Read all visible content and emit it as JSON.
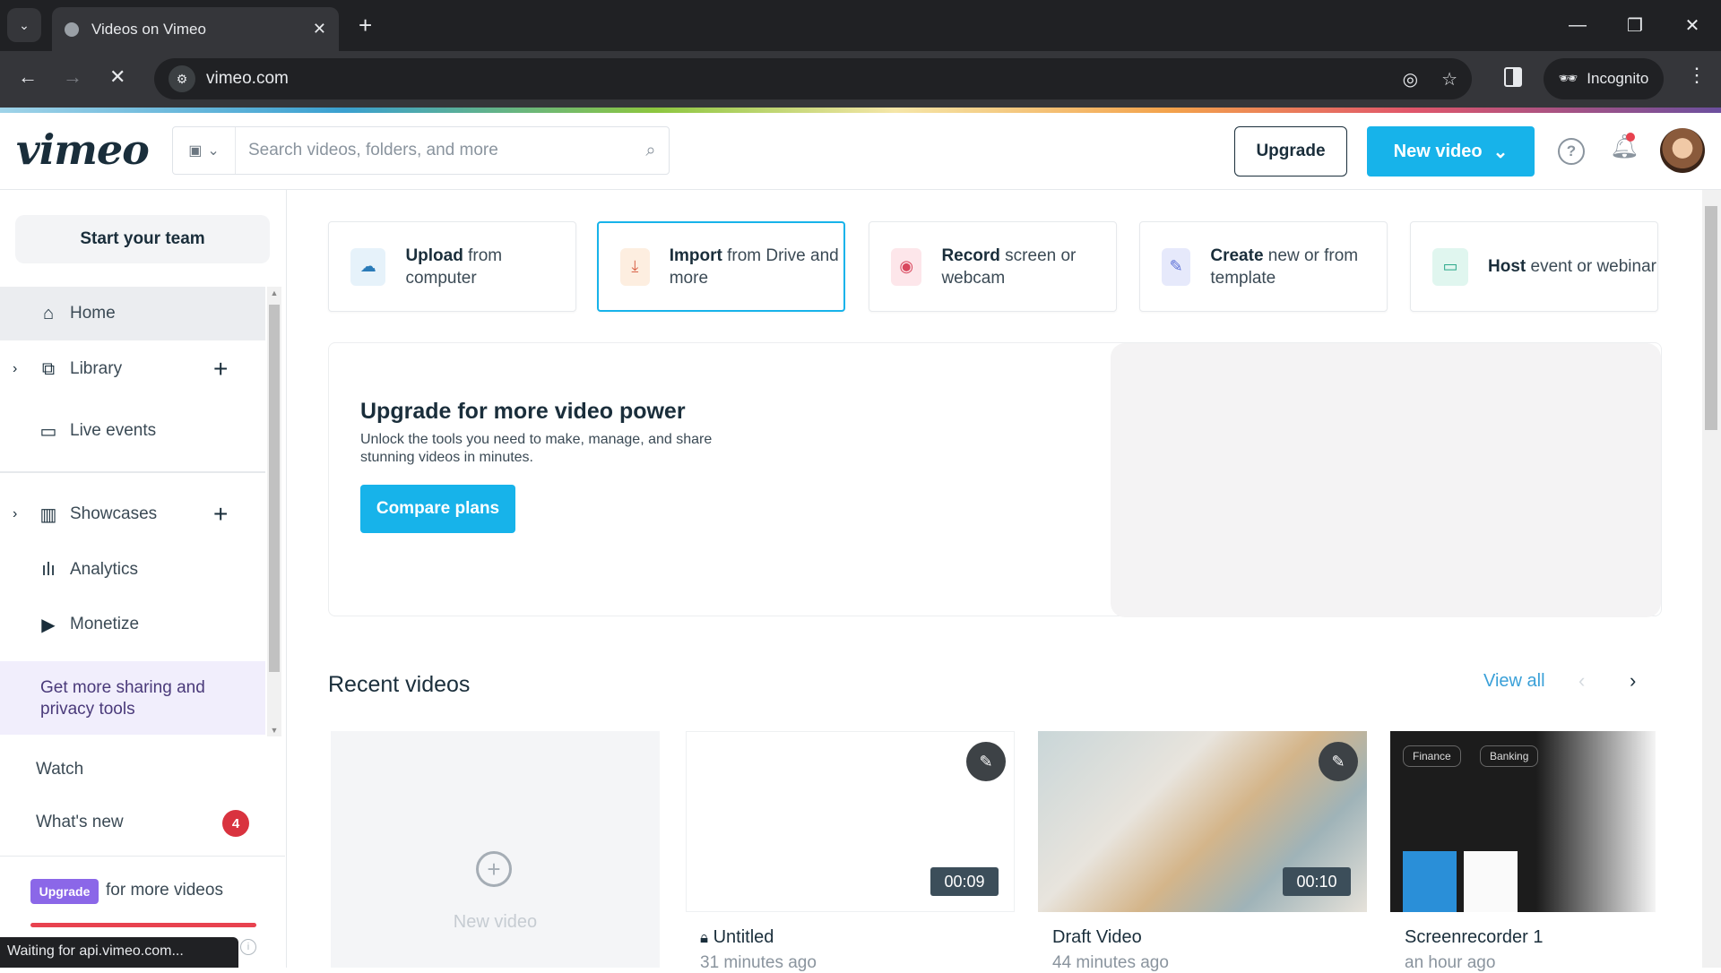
{
  "browser": {
    "tab_title": "Videos on Vimeo",
    "url": "vimeo.com",
    "profile_label": "Incognito",
    "status_text": "Waiting for api.vimeo.com..."
  },
  "header": {
    "logo": "vimeo",
    "search_placeholder": "Search videos, folders, and more",
    "search_value": "",
    "upgrade_label": "Upgrade",
    "new_video_label": "New video",
    "notifications_unread": true
  },
  "sidebar": {
    "start_team_label": "Start your team",
    "items": [
      {
        "label": "Home",
        "icon": "home-icon",
        "active": true
      },
      {
        "label": "Library",
        "icon": "library-icon",
        "expandable": true,
        "addable": true
      },
      {
        "label": "Live events",
        "icon": "video-camera-icon"
      },
      {
        "label": "Showcases",
        "icon": "showcases-icon",
        "expandable": true,
        "addable": true
      },
      {
        "label": "Analytics",
        "icon": "analytics-icon"
      },
      {
        "label": "Monetize",
        "icon": "monetize-icon"
      }
    ],
    "promo_text": "Get more sharing and privacy tools",
    "watch_label": "Watch",
    "whats_new_label": "What's new",
    "whats_new_count": "4",
    "upgrade_pill_label": "Upgrade",
    "upgrade_more_text": "for more videos"
  },
  "quick_actions": [
    {
      "bold": "Upload",
      "rest": " from computer",
      "icon": "upload-cloud-icon",
      "color": "#2a7bb8",
      "bg": "#e6f2fa"
    },
    {
      "bold": "Import",
      "rest": " from Drive and more",
      "icon": "download-icon",
      "color": "#d9644a",
      "bg": "#fdeee0",
      "selected": true
    },
    {
      "bold": "Record",
      "rest": " screen or webcam",
      "icon": "record-icon",
      "color": "#d9485e",
      "bg": "#fde6ea"
    },
    {
      "bold": "Create",
      "rest": " new or from template",
      "icon": "create-edit-icon",
      "color": "#5b6fd6",
      "bg": "#e6e9fb"
    },
    {
      "bold": "Host",
      "rest": " event or webinar",
      "icon": "live-camera-icon",
      "color": "#2ba88a",
      "bg": "#e0f6ef"
    }
  ],
  "banner": {
    "title": "Upgrade for more video power",
    "description": "Unlock the tools you need to make, manage, and share stunning videos in minutes.",
    "cta_label": "Compare plans"
  },
  "recent": {
    "title": "Recent videos",
    "view_all_label": "View all",
    "new_video_label": "New video",
    "videos": [
      {
        "title": "Untitled",
        "meta": "31 minutes ago",
        "duration": "00:09",
        "private": true
      },
      {
        "title": "Draft Video",
        "meta": "44 minutes ago",
        "duration": "00:10"
      },
      {
        "title": "Screenrecorder 1",
        "meta": "an hour ago",
        "thumb_tags": [
          "Finance",
          "Banking"
        ]
      }
    ]
  },
  "colors": {
    "accent": "#17b3ea",
    "upgrade_purple": "#8b67e8",
    "alert_red": "#d9333f"
  }
}
